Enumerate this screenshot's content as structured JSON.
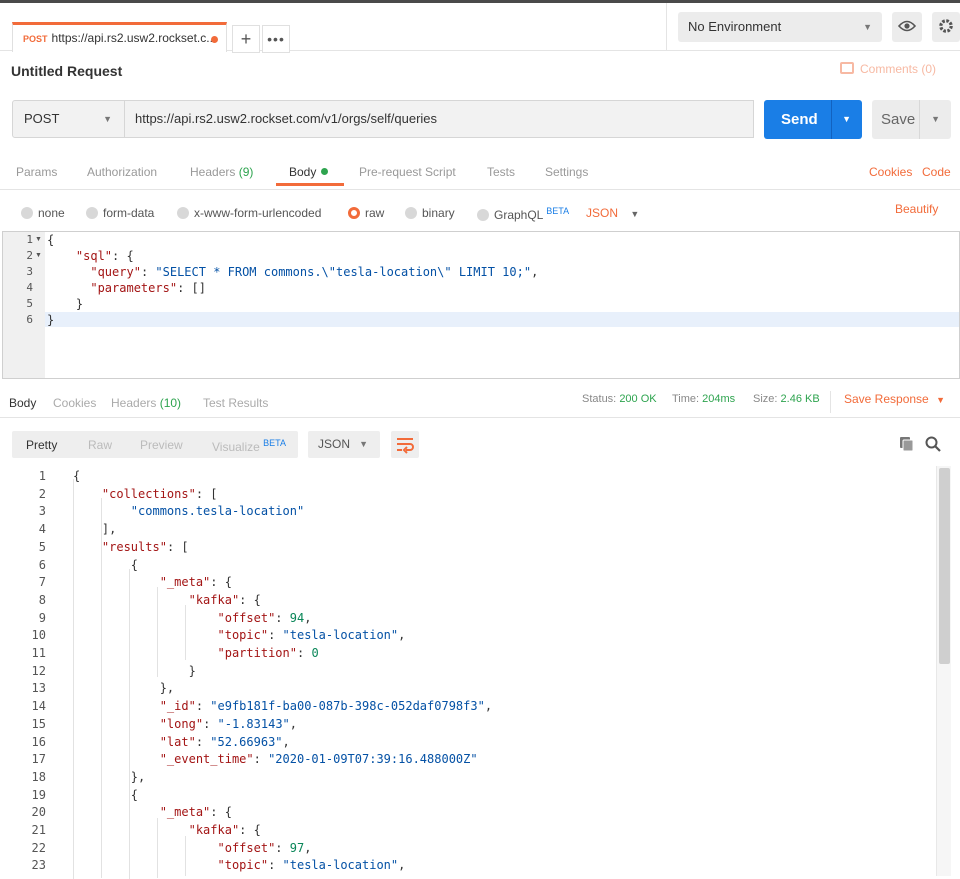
{
  "tab": {
    "method": "POST",
    "title": "https://api.rs2.usw2.rockset.c..."
  },
  "env": {
    "label": "No Environment"
  },
  "request": {
    "title": "Untitled Request",
    "comments": "Comments (0)"
  },
  "url_bar": {
    "method": "POST",
    "url": "https://api.rs2.usw2.rockset.com/v1/orgs/self/queries",
    "send": "Send",
    "save": "Save"
  },
  "req_tabs": {
    "params": "Params",
    "auth": "Authorization",
    "headers": "Headers",
    "headers_count": "(9)",
    "body": "Body",
    "prereq": "Pre-request Script",
    "tests": "Tests",
    "settings": "Settings",
    "cookies": "Cookies",
    "code": "Code"
  },
  "body_types": {
    "none": "none",
    "form_data": "form-data",
    "urlencoded": "x-www-form-urlencoded",
    "raw": "raw",
    "binary": "binary",
    "graphql": "GraphQL",
    "beta": "BETA",
    "json": "JSON",
    "beautify": "Beautify"
  },
  "editor_lines": [
    [
      {
        "t": "p",
        "v": "{"
      }
    ],
    [
      {
        "t": "p",
        "v": "    "
      },
      {
        "t": "k",
        "v": "\"sql\""
      },
      {
        "t": "p",
        "v": ": {"
      }
    ],
    [
      {
        "t": "p",
        "v": "      "
      },
      {
        "t": "k",
        "v": "\"query\""
      },
      {
        "t": "p",
        "v": ": "
      },
      {
        "t": "s",
        "v": "\"SELECT * FROM commons.\\\"tesla-location\\\" LIMIT 10;\""
      },
      {
        "t": "p",
        "v": ","
      }
    ],
    [
      {
        "t": "p",
        "v": "      "
      },
      {
        "t": "k",
        "v": "\"parameters\""
      },
      {
        "t": "p",
        "v": ": []"
      }
    ],
    [
      {
        "t": "p",
        "v": "    }"
      }
    ],
    [
      {
        "t": "p",
        "v": "}"
      }
    ]
  ],
  "resp_tabs": {
    "body": "Body",
    "cookies": "Cookies",
    "headers": "Headers",
    "headers_count": "(10)",
    "tests": "Test Results"
  },
  "status": {
    "status_label": "Status:",
    "status": "200 OK",
    "time_label": "Time:",
    "time": "204ms",
    "size_label": "Size:",
    "size": "2.46 KB",
    "save_response": "Save Response"
  },
  "view": {
    "pretty": "Pretty",
    "raw": "Raw",
    "preview": "Preview",
    "visualize": "Visualize",
    "beta": "BETA",
    "format": "JSON"
  },
  "response_lines": [
    [
      {
        "t": "p",
        "v": "{"
      }
    ],
    [
      {
        "t": "p",
        "v": "    "
      },
      {
        "t": "k",
        "v": "\"collections\""
      },
      {
        "t": "p",
        "v": ": ["
      }
    ],
    [
      {
        "t": "p",
        "v": "        "
      },
      {
        "t": "s",
        "v": "\"commons.tesla-location\""
      }
    ],
    [
      {
        "t": "p",
        "v": "    ],"
      }
    ],
    [
      {
        "t": "p",
        "v": "    "
      },
      {
        "t": "k",
        "v": "\"results\""
      },
      {
        "t": "p",
        "v": ": ["
      }
    ],
    [
      {
        "t": "p",
        "v": "        {"
      }
    ],
    [
      {
        "t": "p",
        "v": "            "
      },
      {
        "t": "k",
        "v": "\"_meta\""
      },
      {
        "t": "p",
        "v": ": {"
      }
    ],
    [
      {
        "t": "p",
        "v": "                "
      },
      {
        "t": "k",
        "v": "\"kafka\""
      },
      {
        "t": "p",
        "v": ": {"
      }
    ],
    [
      {
        "t": "p",
        "v": "                    "
      },
      {
        "t": "k",
        "v": "\"offset\""
      },
      {
        "t": "p",
        "v": ": "
      },
      {
        "t": "n",
        "v": "94"
      },
      {
        "t": "p",
        "v": ","
      }
    ],
    [
      {
        "t": "p",
        "v": "                    "
      },
      {
        "t": "k",
        "v": "\"topic\""
      },
      {
        "t": "p",
        "v": ": "
      },
      {
        "t": "s",
        "v": "\"tesla-location\""
      },
      {
        "t": "p",
        "v": ","
      }
    ],
    [
      {
        "t": "p",
        "v": "                    "
      },
      {
        "t": "k",
        "v": "\"partition\""
      },
      {
        "t": "p",
        "v": ": "
      },
      {
        "t": "n",
        "v": "0"
      }
    ],
    [
      {
        "t": "p",
        "v": "                }"
      }
    ],
    [
      {
        "t": "p",
        "v": "            },"
      }
    ],
    [
      {
        "t": "p",
        "v": "            "
      },
      {
        "t": "k",
        "v": "\"_id\""
      },
      {
        "t": "p",
        "v": ": "
      },
      {
        "t": "s",
        "v": "\"e9fb181f-ba00-087b-398c-052daf0798f3\""
      },
      {
        "t": "p",
        "v": ","
      }
    ],
    [
      {
        "t": "p",
        "v": "            "
      },
      {
        "t": "k",
        "v": "\"long\""
      },
      {
        "t": "p",
        "v": ": "
      },
      {
        "t": "s",
        "v": "\"-1.83143\""
      },
      {
        "t": "p",
        "v": ","
      }
    ],
    [
      {
        "t": "p",
        "v": "            "
      },
      {
        "t": "k",
        "v": "\"lat\""
      },
      {
        "t": "p",
        "v": ": "
      },
      {
        "t": "s",
        "v": "\"52.66963\""
      },
      {
        "t": "p",
        "v": ","
      }
    ],
    [
      {
        "t": "p",
        "v": "            "
      },
      {
        "t": "k",
        "v": "\"_event_time\""
      },
      {
        "t": "p",
        "v": ": "
      },
      {
        "t": "s",
        "v": "\"2020-01-09T07:39:16.488000Z\""
      }
    ],
    [
      {
        "t": "p",
        "v": "        },"
      }
    ],
    [
      {
        "t": "p",
        "v": "        {"
      }
    ],
    [
      {
        "t": "p",
        "v": "            "
      },
      {
        "t": "k",
        "v": "\"_meta\""
      },
      {
        "t": "p",
        "v": ": {"
      }
    ],
    [
      {
        "t": "p",
        "v": "                "
      },
      {
        "t": "k",
        "v": "\"kafka\""
      },
      {
        "t": "p",
        "v": ": {"
      }
    ],
    [
      {
        "t": "p",
        "v": "                    "
      },
      {
        "t": "k",
        "v": "\"offset\""
      },
      {
        "t": "p",
        "v": ": "
      },
      {
        "t": "n",
        "v": "97"
      },
      {
        "t": "p",
        "v": ","
      }
    ],
    [
      {
        "t": "p",
        "v": "                    "
      },
      {
        "t": "k",
        "v": "\"topic\""
      },
      {
        "t": "p",
        "v": ": "
      },
      {
        "t": "s",
        "v": "\"tesla-location\""
      },
      {
        "t": "p",
        "v": ","
      }
    ]
  ],
  "colors": {
    "accent": "#f26b3a",
    "send": "#1a7ee6",
    "ok": "#2ea44f"
  }
}
